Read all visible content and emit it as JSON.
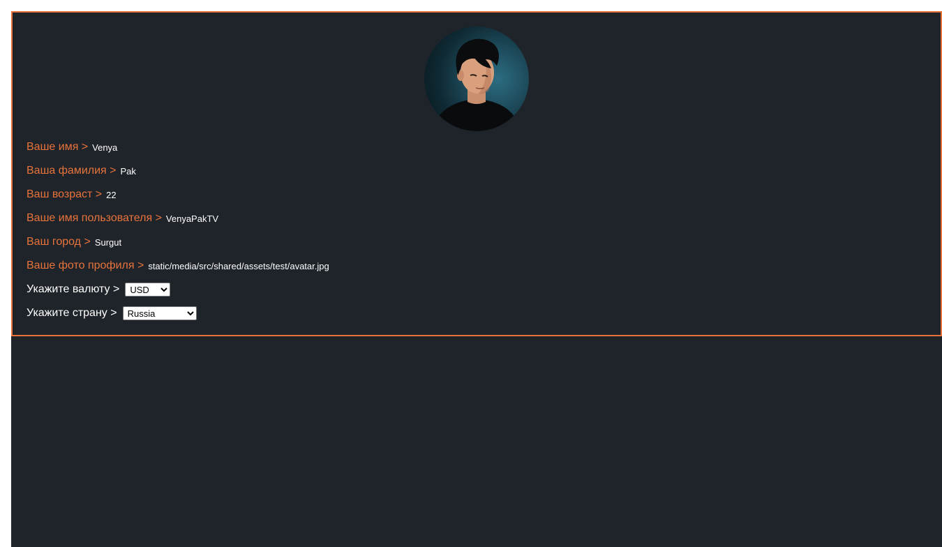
{
  "profile": {
    "fields": [
      {
        "label": "Ваше имя >",
        "value": "Venya"
      },
      {
        "label": "Ваша фамилия >",
        "value": "Pak"
      },
      {
        "label": "Ваш возраст >",
        "value": "22"
      },
      {
        "label": "Ваше имя пользователя >",
        "value": "VenyaPakTV"
      },
      {
        "label": "Ваш город >",
        "value": "Surgut"
      },
      {
        "label": "Ваше фото профиля >",
        "value": "static/media/src/shared/assets/test/avatar.jpg"
      }
    ],
    "currency": {
      "label": "Укажите валюту >",
      "selected": "USD"
    },
    "country": {
      "label": "Укажите страну >",
      "selected": "Russia"
    }
  },
  "colors": {
    "accent": "#e8743b",
    "background": "#1f232a",
    "text": "#ffffff"
  }
}
